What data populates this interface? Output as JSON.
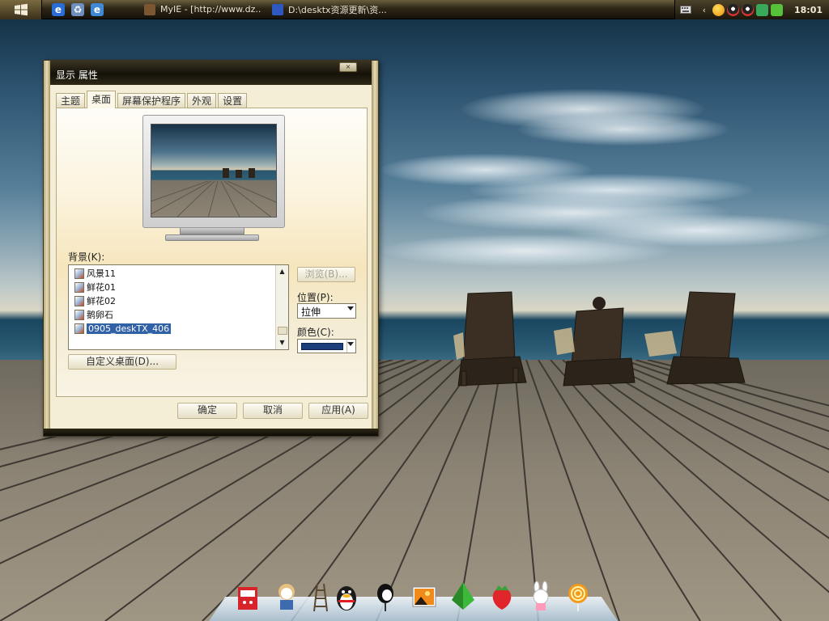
{
  "taskbar": {
    "start_label": "",
    "tasks": [
      {
        "label": "MyIE - [http://www.dz...",
        "icon": "myie-icon"
      },
      {
        "label": "D:\\desktx资源更新\\资...",
        "icon": "folder-icon"
      }
    ],
    "tray_icons": [
      "keyboard-icon",
      "show-hidden-icon",
      "smiley-icon",
      "qq-icon",
      "qq-icon-2",
      "chat-icon",
      "update-icon"
    ],
    "clock": "18:01"
  },
  "window": {
    "title": "显示 属性",
    "close_label": "×",
    "tabs": [
      "主题",
      "桌面",
      "屏幕保护程序",
      "外观",
      "设置"
    ],
    "active_tab": "桌面",
    "background_label": "背景(K):",
    "background_items": [
      "风景11",
      "鲜花01",
      "鲜花02",
      "鹅卵石",
      "0905_deskTX_406"
    ],
    "selected_item": "0905_deskTX_406",
    "browse_button": "浏览(B)...",
    "position_label": "位置(P):",
    "position_value": "拉伸",
    "color_label": "颜色(C):",
    "color_value": "#1a3f7a",
    "customize_button": "自定义桌面(D)...",
    "ok_button": "确定",
    "cancel_button": "取消",
    "apply_button": "应用(A)"
  },
  "dock": {
    "items": [
      "milk-box-icon",
      "penguin-sailor-icon",
      "railway-icon",
      "qq-penguin-icon",
      "magpie-icon",
      "photo-icon",
      "green-arrow-icon",
      "strawberry-icon",
      "rabbit-icon",
      "lollipop-icon"
    ]
  },
  "colors": {
    "taskbar": "#2d2616",
    "titlebar": "#15120a",
    "selection": "#3162a8"
  }
}
